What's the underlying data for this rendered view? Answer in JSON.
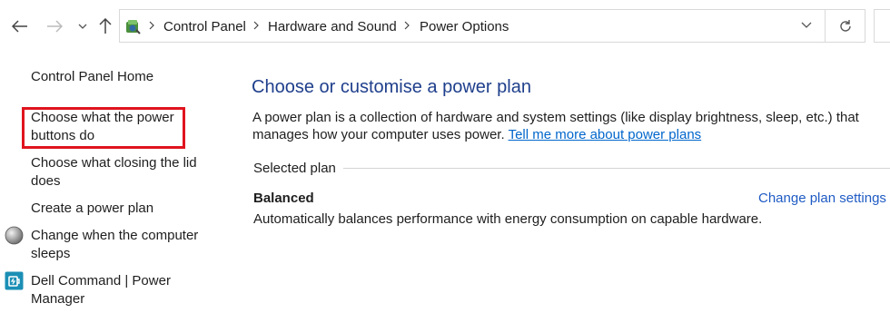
{
  "address_bar": {
    "breadcrumbs": [
      "Control Panel",
      "Hardware and Sound",
      "Power Options"
    ]
  },
  "sidebar": {
    "items": [
      {
        "label": "Control Panel Home"
      },
      {
        "label_lines": [
          "Choose what the power",
          "buttons do"
        ]
      },
      {
        "label_lines": [
          "Choose what closing the lid",
          "does"
        ]
      },
      {
        "label": "Create a power plan"
      },
      {
        "label_lines": [
          "Change when the computer",
          "sleeps"
        ]
      },
      {
        "label_lines": [
          "Dell Command | Power",
          "Manager"
        ]
      }
    ]
  },
  "main": {
    "title": "Choose or customise a power plan",
    "description": "A power plan is a collection of hardware and system settings (like display brightness, sleep, etc.) that manages how your computer uses power.",
    "description_link": "Tell me more about power plans",
    "selected_plan_label": "Selected plan",
    "plan": {
      "name": "Balanced",
      "change_link": "Change plan settings",
      "description": "Automatically balances performance with energy consumption on capable hardware."
    }
  },
  "icons": {
    "back": "back-arrow-icon",
    "forward": "forward-arrow-icon",
    "recent": "chevron-down-icon",
    "up": "up-arrow-icon",
    "location": "control-panel-icon",
    "refresh": "refresh-icon"
  },
  "colors": {
    "title": "#1f3f8c",
    "link": "#0066cc",
    "highlight_box": "#e0141e"
  }
}
